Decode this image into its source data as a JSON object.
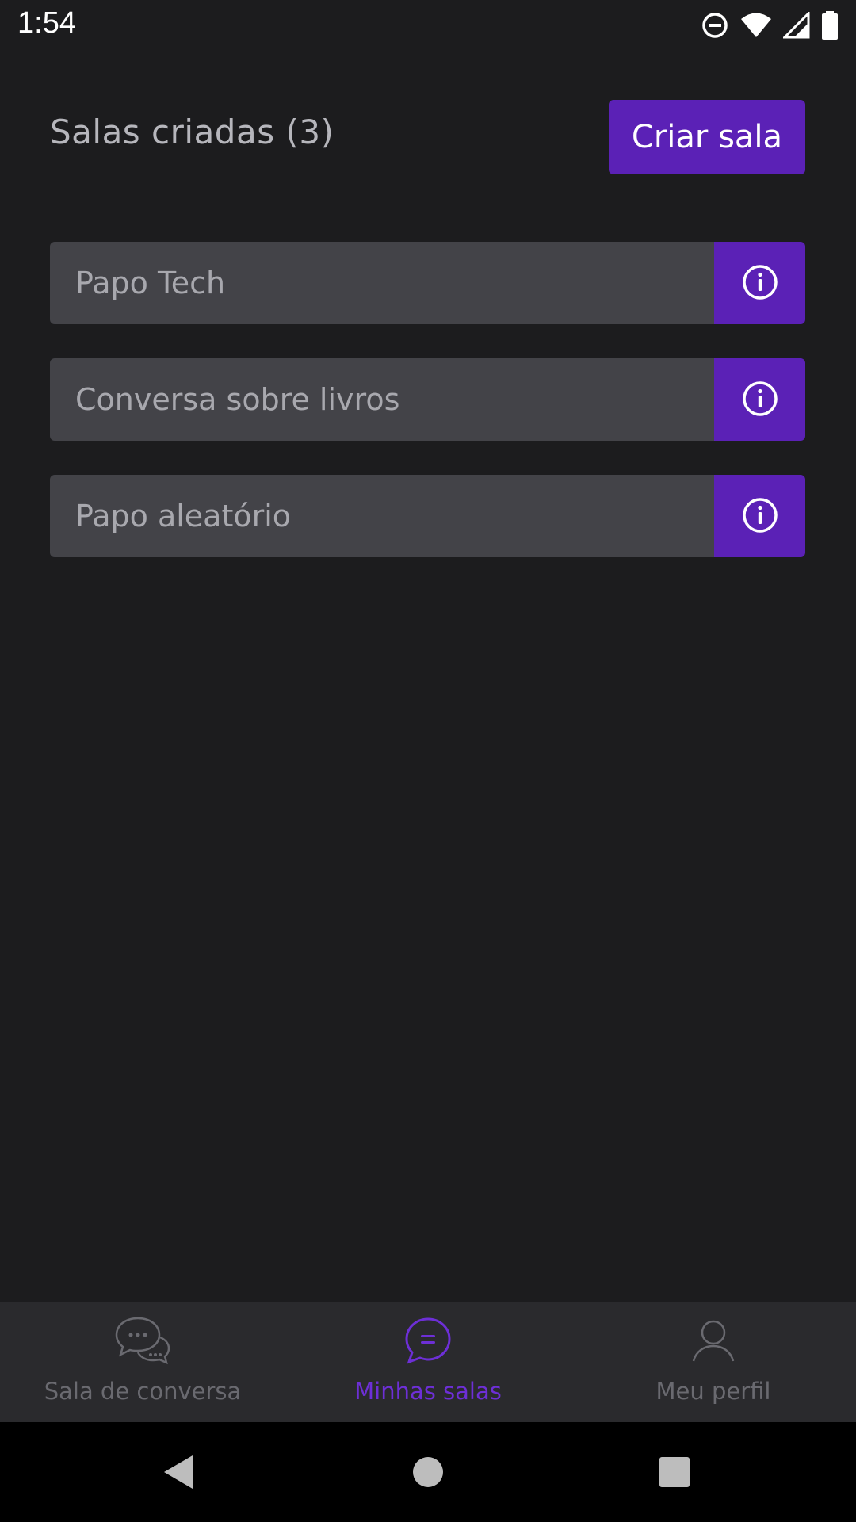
{
  "status_bar": {
    "time": "1:54",
    "icons": [
      "do-not-disturb-icon",
      "wifi-icon",
      "signal-icon",
      "battery-icon"
    ]
  },
  "header": {
    "title": "Salas criadas (3)",
    "create_button_label": "Criar sala"
  },
  "rooms": [
    {
      "name": "Papo Tech"
    },
    {
      "name": "Conversa sobre livros"
    },
    {
      "name": "Papo aleatório"
    }
  ],
  "bottom_nav": {
    "items": [
      {
        "label": "Sala de conversa",
        "icon": "chat-bubbles-icon",
        "active": false
      },
      {
        "label": "Minhas salas",
        "icon": "message-icon",
        "active": true
      },
      {
        "label": "Meu perfil",
        "icon": "user-icon",
        "active": false
      }
    ]
  },
  "colors": {
    "background": "#1c1c1e",
    "accent": "#5b21b6",
    "row_background": "#434348",
    "nav_background": "#2a2a2d",
    "active_label": "#6d2fd6"
  }
}
